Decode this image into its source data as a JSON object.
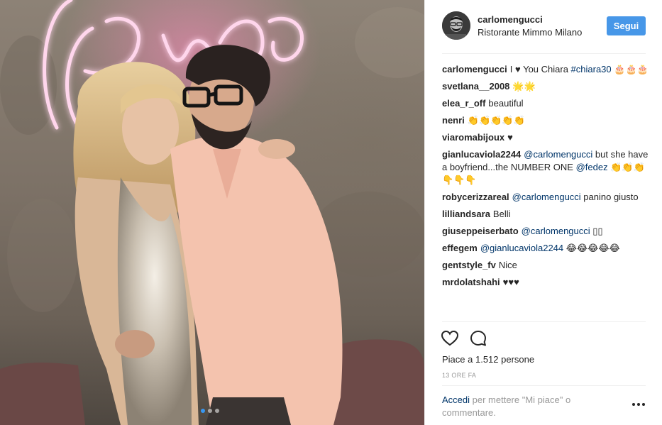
{
  "photo": {
    "alt_icons": [
      "neon-sign",
      "carousel-dots"
    ],
    "carousel": {
      "count": 3,
      "active_index": 1
    }
  },
  "header": {
    "username": "carlomengucci",
    "location": "Ristorante Mimmo Milano",
    "follow_label": "Segui"
  },
  "comments": [
    {
      "user": "carlomengucci",
      "parts": [
        {
          "t": "text",
          "v": "I ♥ You Chiara "
        },
        {
          "t": "mention",
          "v": "#chiara30"
        },
        {
          "t": "text",
          "v": " 🎂🎂🎂"
        }
      ]
    },
    {
      "user": "svetlana__2008",
      "parts": [
        {
          "t": "text",
          "v": "🌟🌟"
        }
      ]
    },
    {
      "user": "elea_r_off",
      "parts": [
        {
          "t": "text",
          "v": "beautiful"
        }
      ]
    },
    {
      "user": "nenri",
      "parts": [
        {
          "t": "text",
          "v": "👏👏👏👏👏"
        }
      ]
    },
    {
      "user": "viaromabijoux",
      "parts": [
        {
          "t": "text",
          "v": "♥"
        }
      ]
    },
    {
      "user": "gianlucaviola2244",
      "parts": [
        {
          "t": "mention",
          "v": "@carlomengucci"
        },
        {
          "t": "text",
          "v": " but she have a boyfriend...the NUMBER ONE "
        },
        {
          "t": "mention",
          "v": "@fedez"
        },
        {
          "t": "text",
          "v": " 👏👏👏👇👇👇"
        }
      ]
    },
    {
      "user": "robycerizzareal",
      "parts": [
        {
          "t": "mention",
          "v": "@carlomengucci"
        },
        {
          "t": "text",
          "v": " panino giusto"
        }
      ]
    },
    {
      "user": "lilliandsara",
      "parts": [
        {
          "t": "text",
          "v": "Belli"
        }
      ]
    },
    {
      "user": "giuseppeiserbato",
      "parts": [
        {
          "t": "mention",
          "v": "@carlomengucci"
        },
        {
          "t": "text",
          "v": " ▯▯"
        }
      ]
    },
    {
      "user": "effegem",
      "parts": [
        {
          "t": "mention",
          "v": "@gianlucaviola2244"
        },
        {
          "t": "text",
          "v": " 😂😂😂😂😂"
        }
      ]
    },
    {
      "user": "gentstyle_fv",
      "parts": [
        {
          "t": "text",
          "v": "Nice"
        }
      ]
    },
    {
      "user": "mrdolatshahi",
      "parts": [
        {
          "t": "text",
          "v": "♥♥♥"
        }
      ]
    }
  ],
  "actions": {
    "like_icon": "heart-outline-icon",
    "comment_icon": "comment-bubble-icon",
    "likes_text": "Piace a 1.512 persone",
    "timestamp": "13 ORE FA"
  },
  "footer": {
    "login_link": "Accedi",
    "login_rest": " per mettere \"Mi piace\" o commentare.",
    "more_icon": "more-options-icon"
  },
  "colors": {
    "follow_button": "#4797e8",
    "mention": "#003569",
    "muted": "#999999",
    "text": "#262626"
  }
}
